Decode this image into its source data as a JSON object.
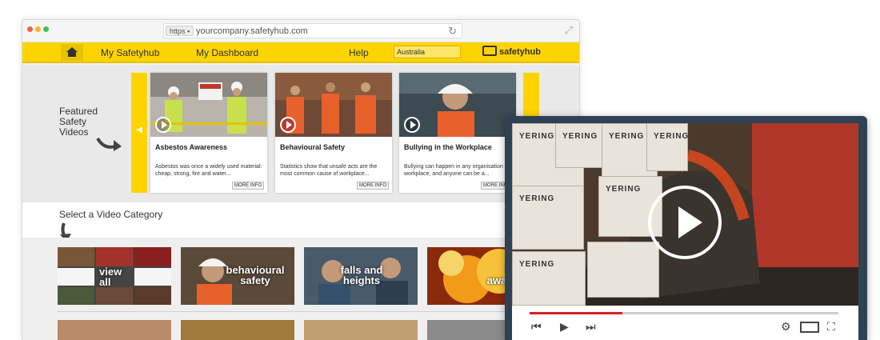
{
  "browser": {
    "scheme_badge": "https",
    "lock_icon": "lock-icon",
    "url": "yourcompany.safetyhub.com"
  },
  "nav": {
    "home_icon": "home-icon",
    "items": [
      {
        "label": "My Safetyhub"
      },
      {
        "label": "My Dashboard"
      },
      {
        "label": "Help"
      }
    ],
    "country": "Australia",
    "brand": "safetyhub",
    "accent": "#fdd400"
  },
  "featured": {
    "heading": "Featured Safety Videos",
    "cards": [
      {
        "title": "Asbestos Awareness",
        "desc": "Asbestos was once a widely used material: cheap, strong, fire and water...",
        "more": "MORE INFO"
      },
      {
        "title": "Behavioural Safety",
        "desc": "Statistics show that unsafe acts are the most common cause of workplace...",
        "more": "MORE INFO"
      },
      {
        "title": "Bullying in the Workplace",
        "desc": "Bullying can happen in any organisation or workplace, and anyone can be a...",
        "more": "MORE INFO"
      }
    ]
  },
  "categories": {
    "heading": "Select a Video Category",
    "tiles": [
      {
        "label": "view all"
      },
      {
        "label": "behavioural safety"
      },
      {
        "label": "falls and heights"
      },
      {
        "label": "fire awareness"
      }
    ]
  },
  "player": {
    "box_label": "YERING",
    "progress": 0.3,
    "progress_color": "#d62121"
  }
}
